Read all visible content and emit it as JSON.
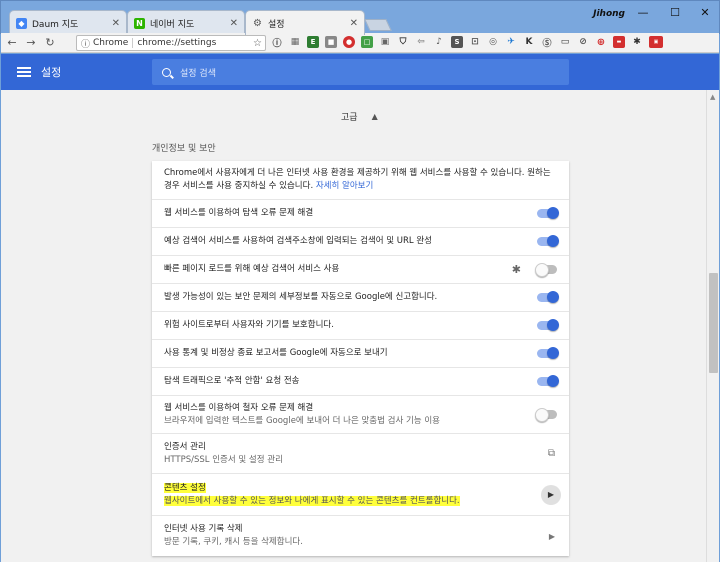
{
  "browser": {
    "tabs": [
      {
        "label": "Daum 지도",
        "favicon": "google-maps-icon",
        "color": "#4285f4"
      },
      {
        "label": "네이버 지도",
        "favicon": "naver-n-icon",
        "color": "#2db400"
      },
      {
        "label": "설정",
        "favicon": "gear-icon",
        "color": "#555555"
      }
    ],
    "user_name": "Jihong",
    "omnibox": {
      "scheme_label": "Chrome",
      "url": "chrome://settings"
    }
  },
  "appbar": {
    "title": "설정",
    "search_placeholder": "설정 검색",
    "color": "#3367d6"
  },
  "content": {
    "advanced_label": "고급",
    "section_title": "개인정보 및 보안",
    "intro": {
      "text": "Chrome에서 사용자에게 더 나은 인터넷 사용 환경을 제공하기 위해 웹 서비스를 사용할 수 있습니다. 원하는 경우 서비스를 사용 중지하실 수 있습니다.",
      "link": "자세히 알아보기"
    },
    "toggles": [
      {
        "label": "웹 서비스를 이용하여 탐색 오류 문제 해결",
        "on": true
      },
      {
        "label": "예상 검색어 서비스를 사용하여 검색주소창에 입력되는 검색어 및 URL 완성",
        "on": true
      },
      {
        "label": "빠른 페이지 로드를 위해 예상 검색어 서비스 사용",
        "on": false
      },
      {
        "label": "발생 가능성이 있는 보안 문제의 세부정보를 자동으로 Google에 신고합니다.",
        "on": true
      },
      {
        "label": "위험 사이트로부터 사용자와 기기를 보호합니다.",
        "on": true
      },
      {
        "label": "사용 통계 및 비정상 종료 보고서를 Google에 자동으로 보내기",
        "on": true
      },
      {
        "label": "탐색 트래픽으로 '추적 안함' 요청 전송",
        "on": true
      }
    ],
    "spelling": {
      "label": "웹 서비스를 이용하여 철자 오류 문제 해결",
      "sub": "브라우저에 입력한 텍스트를 Google에 보내어 더 나은 맞춤법 검사 기능 이용",
      "on": false
    },
    "certificates": {
      "label": "인증서 관리",
      "sub": "HTTPS/SSL 인증서 및 설정 관리"
    },
    "content_settings": {
      "label": "콘텐츠 설정",
      "sub": "웹사이트에서 사용할 수 있는 정보와 나에게 표시할 수 있는 콘텐츠를 컨트롤합니다.",
      "highlight": "#ffff3b"
    },
    "clear_data": {
      "label": "인터넷 사용 기록 삭제",
      "sub": "방문 기록, 쿠키, 캐시 등을 삭제합니다."
    }
  }
}
